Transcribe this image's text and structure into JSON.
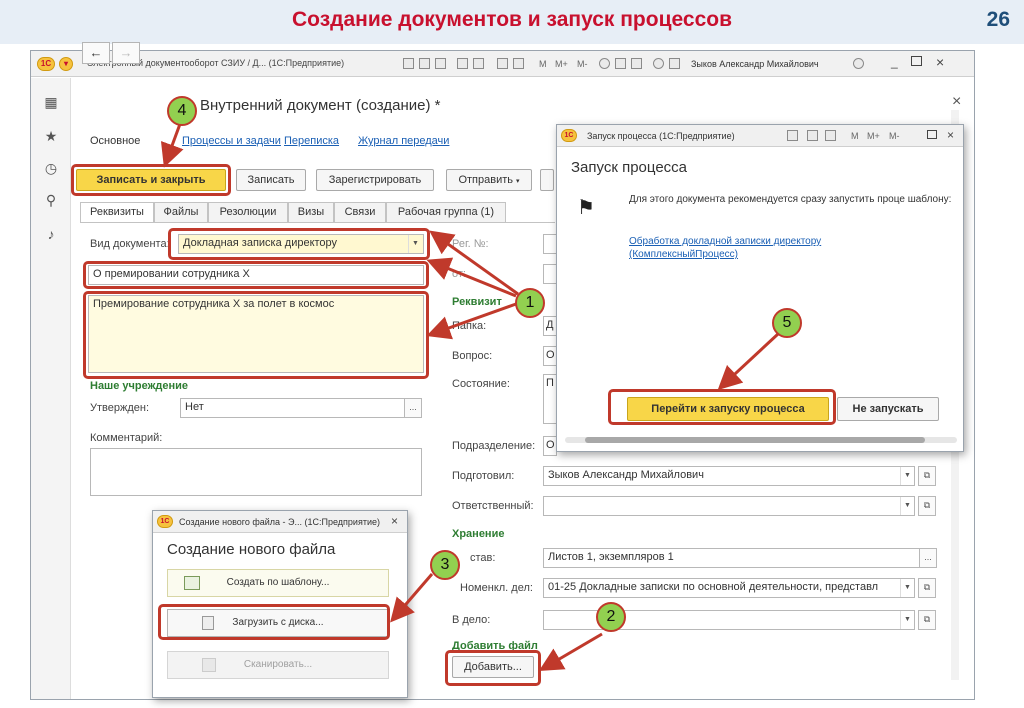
{
  "slide": {
    "title": "Создание документов и запуск процессов",
    "number": "26"
  },
  "window": {
    "title": "Электронный документооборот СЗИУ / Д... (1С:Предприятие)",
    "toolbar_text": {
      "m": "M",
      "m_plus": "M+",
      "m_minus": "M-"
    },
    "user": "Зыков Александр Михайлович",
    "logo": "1С"
  },
  "document": {
    "title": "Внутренний документ (создание) *",
    "nav": {
      "back": "←",
      "forward": "→"
    },
    "close": "×",
    "sections": {
      "main": "Основное",
      "processes": "Процессы и задачи",
      "correspondence": "Переписка",
      "transfer_log": "Журнал передачи"
    },
    "buttons": {
      "save_close": "Записать и закрыть",
      "save": "Записать",
      "register": "Зарегистрировать",
      "send": "Отправить"
    },
    "tabs": [
      "Реквизиты",
      "Файлы",
      "Резолюции",
      "Визы",
      "Связи",
      "Рабочая группа (1)"
    ],
    "fields": {
      "doc_type_label": "Вид документа:",
      "doc_type_value": "Докладная записка директору",
      "subject_value": "О премировании сотрудника Х",
      "content_value": "Премирование сотрудника Х за полет в космос",
      "our_org_header": "Наше учреждение",
      "approved_label": "Утвержден:",
      "approved_value": "Нет",
      "comment_label": "Комментарий:",
      "reg_no_label": "Рег. №:",
      "from_label": "от:",
      "requisites_header": "Реквизит",
      "folder_label": "Папка:",
      "folder_value": "Д",
      "question_label": "Вопрос:",
      "question_value": "О",
      "state_label": "Состояние:",
      "state_value": "П",
      "department_label": "Подразделение:",
      "department_value": "О",
      "prepared_label": "Подготовил:",
      "prepared_value": "Зыков Александр Михайлович",
      "responsible_label": "Ответственный:",
      "storage_header": "Хранение",
      "composition_label": "став:",
      "composition_value": "Листов 1, экземпляров 1",
      "nomencl_label": "Номенкл. дел:",
      "nomencl_value": "01-25 Докладные записки по основной деятельности, представл",
      "case_label": "В дело:",
      "add_file_header": "Добавить файл",
      "add_button": "Добавить..."
    }
  },
  "process_dialog": {
    "title": "Запуск процесса (1С:Предприятие)",
    "heading": "Запуск процесса",
    "text": "Для этого документа рекомендуется сразу запустить проце шаблону:",
    "link": "Обработка докладной записки директору (КомплексныйПроцесс)",
    "go_button": "Перейти к запуску процесса",
    "skip_button": "Не запускать"
  },
  "file_dialog": {
    "title": "Создание нового файла - Э... (1С:Предприятие)",
    "heading": "Создание нового файла",
    "template_button": "Создать по шаблону...",
    "disk_button": "Загрузить с диска...",
    "scan_button": "Сканировать..."
  },
  "badges": [
    "1",
    "2",
    "3",
    "4",
    "5"
  ],
  "colors": {
    "title_red": "#c8102e",
    "highlight_red": "#c0392b",
    "badge_green": "#92d050",
    "button_yellow": "#f8d648",
    "link_blue": "#1a5fb4",
    "header_green": "#2e7d32"
  }
}
